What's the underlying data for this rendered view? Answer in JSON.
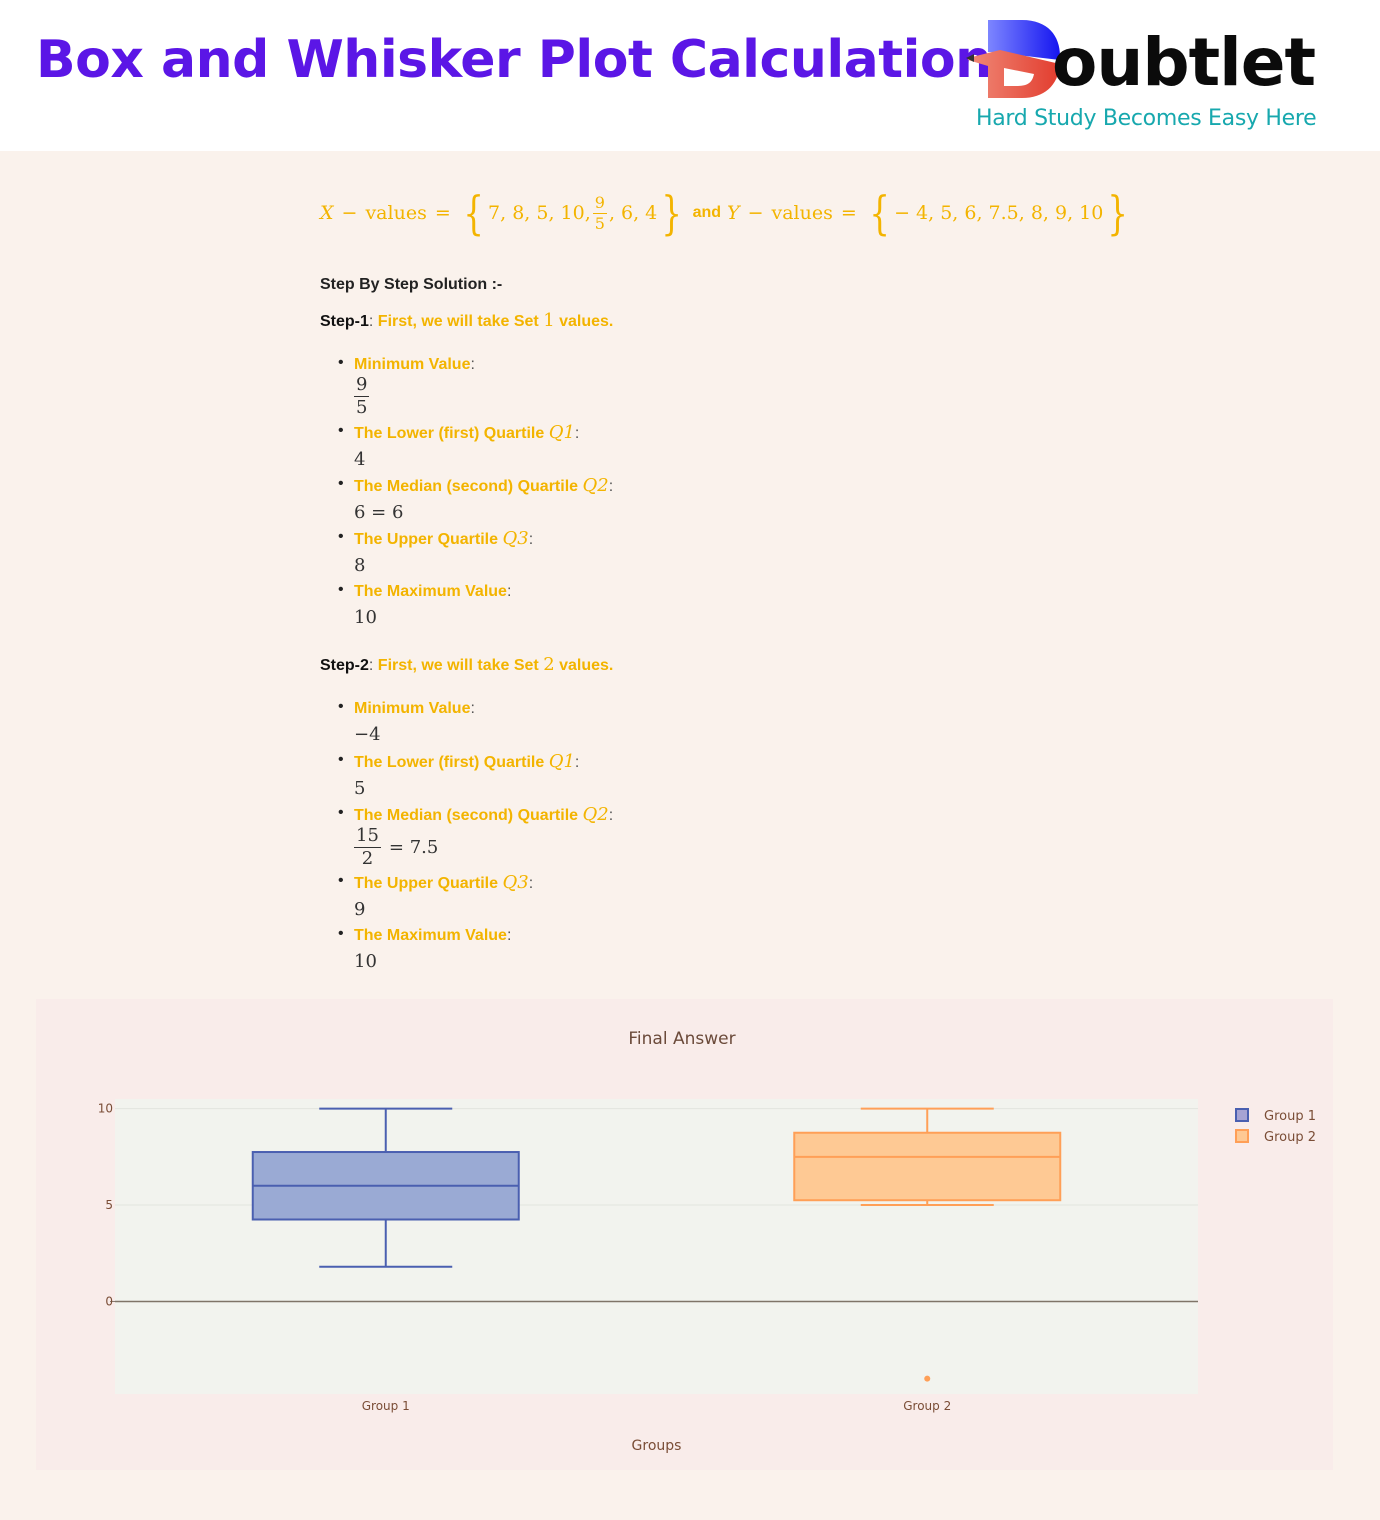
{
  "header": {
    "title": "Box and Whisker Plot Calculation",
    "logo_word": "oubtlet",
    "logo_tagline": "Hard Study Becomes Easy Here"
  },
  "problem": {
    "x_label": "X",
    "y_label": "Y",
    "values_word": "values",
    "minus": "−",
    "equals": "=",
    "x_values_before": "7, 8, 5, 10,",
    "x_frac_num": "9",
    "x_frac_den": "5",
    "x_values_after": ", 6, 4",
    "and_word": "and",
    "y_values": "− 4, 5, 6, 7.5, 8, 9, 10"
  },
  "solution": {
    "heading": "Step By Step Solution :-",
    "steps": [
      {
        "label": "Step-1",
        "title_pre": "First, we will take Set ",
        "set_num": "1",
        "title_post": " values.",
        "items": [
          {
            "label": "Minimum Value",
            "q": "",
            "value_num": "9",
            "value_den": "5",
            "value_text": ""
          },
          {
            "label": "The Lower (first) Quartile ",
            "q": "Q1",
            "value_text": "4"
          },
          {
            "label": "The Median (second) Quartile ",
            "q": "Q2",
            "value_text": "6 = 6"
          },
          {
            "label": "The Upper Quartile ",
            "q": "Q3",
            "value_text": "8"
          },
          {
            "label": "The Maximum Value",
            "q": "",
            "value_text": "10"
          }
        ]
      },
      {
        "label": "Step-2",
        "title_pre": "First, we will take Set ",
        "set_num": "2",
        "title_post": " values.",
        "items": [
          {
            "label": "Minimum Value",
            "q": "",
            "value_text": "−4"
          },
          {
            "label": "The Lower (first) Quartile ",
            "q": "Q1",
            "value_text": "5"
          },
          {
            "label": "The Median (second) Quartile ",
            "q": "Q2",
            "value_num": "15",
            "value_den": "2",
            "value_text": "= 7.5"
          },
          {
            "label": "The Upper Quartile ",
            "q": "Q3",
            "value_text": "9"
          },
          {
            "label": "The Maximum Value",
            "q": "",
            "value_text": "10"
          }
        ]
      }
    ]
  },
  "colors": {
    "title": "#5b16e6",
    "accent": "#f3b400",
    "group1_line": "#4a5fb0",
    "group1_fill": "#9aaad4",
    "group2_line": "#ff9f57",
    "group2_fill": "#fec994",
    "paper_bg": "#f9ecea",
    "plot_bg": "#f2f3ee",
    "axis_text": "#7a4d36"
  },
  "chart_data": {
    "type": "box",
    "title": "Final Answer",
    "xlabel": "Groups",
    "ylabel": "",
    "categories": [
      "Group 1",
      "Group 2"
    ],
    "ylim": [
      -4.8,
      10.5
    ],
    "yticks": [
      0,
      5,
      10
    ],
    "grid": true,
    "legend_position": "top-right",
    "series": [
      {
        "name": "Group 1",
        "min": 1.8,
        "q1": 4.25,
        "median": 6,
        "q3": 7.75,
        "max": 10,
        "outliers": []
      },
      {
        "name": "Group 2",
        "min": 5,
        "q1": 5.25,
        "median": 7.5,
        "q3": 8.75,
        "max": 10,
        "outliers": [
          -4
        ]
      }
    ]
  }
}
